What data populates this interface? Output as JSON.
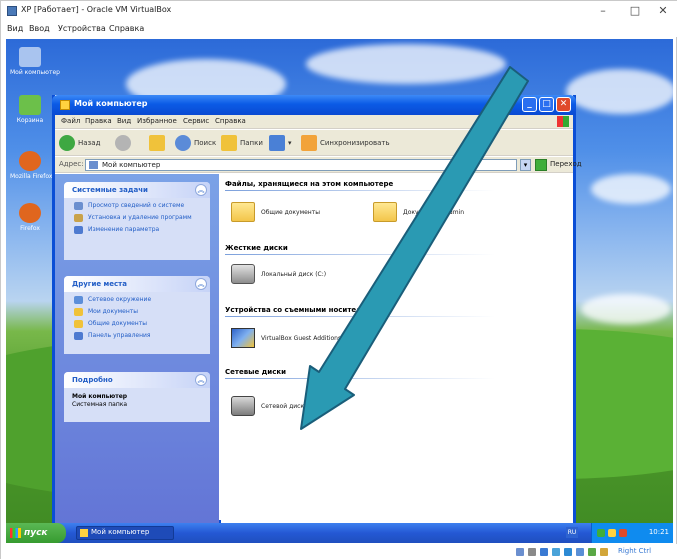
{
  "host": {
    "title": "XP [Работает] - Oracle VM VirtualBox",
    "menu": [
      "Вид",
      "Ввод",
      "Устройства",
      "Справка"
    ],
    "controls": {
      "minimize": "–",
      "maximize": "□",
      "close": "✕"
    }
  },
  "desktop": {
    "icons": [
      {
        "label": "Мой компьютер",
        "icon": "computer-icon",
        "color": "#a9c4ef"
      },
      {
        "label": "Корзина",
        "icon": "recycle-bin-icon",
        "color": "#6cc04a"
      },
      {
        "label": "Mozilla Firefox",
        "icon": "firefox-icon",
        "color": "#e0661e"
      },
      {
        "label": "Firefox",
        "icon": "firefox-icon",
        "color": "#e0661e"
      }
    ]
  },
  "window": {
    "title": "Мой компьютер",
    "controls": {
      "minimize": "_",
      "maximize": "□",
      "close": "✕"
    },
    "menu": [
      "Файл",
      "Правка",
      "Вид",
      "Избранное",
      "Сервис",
      "Справка"
    ],
    "toolbar": {
      "back": "Назад",
      "search": "Поиск",
      "folders": "Папки",
      "sync": "Синхронизировать"
    },
    "address": {
      "label": "Адрес:",
      "value": "Мой компьютер",
      "go": "Переход"
    }
  },
  "taskpane": {
    "system_tasks": {
      "title": "Системные задачи",
      "links": [
        "Просмотр сведений о системе",
        "Установка и удаление программ",
        "Изменение параметра"
      ]
    },
    "other_places": {
      "title": "Другие места",
      "links": [
        "Сетевое окружение",
        "Мои документы",
        "Общие документы",
        "Панель управления"
      ]
    },
    "details": {
      "title": "Подробно",
      "lines": [
        "Мой компьютер",
        "Системная папка"
      ]
    }
  },
  "content": {
    "groups": [
      {
        "title": "Файлы, хранящиеся на этом компьютере"
      },
      {
        "title": "Жесткие диски"
      },
      {
        "title": "Устройства со съемными носителями"
      },
      {
        "title": "Сетевые диски"
      }
    ],
    "items": {
      "shared_docs": "Общие документы",
      "admin_docs": "Документы - Admin",
      "local_disk": "Локальный диск (C:)",
      "cd_drive": "VirtualBox Guest Additions (D:)",
      "net_drive": "Сетевой диск (Z:)"
    }
  },
  "taskbar": {
    "start": "пуск",
    "task": "Мой компьютер",
    "lang": "RU",
    "clock": "10:21"
  },
  "host_status": {
    "hostkey": "Right Ctrl"
  },
  "colors": {
    "xp_blue": "#0a4ed6",
    "arrow_fill": "#2a9ab3",
    "arrow_stroke": "#1a5e7a"
  }
}
